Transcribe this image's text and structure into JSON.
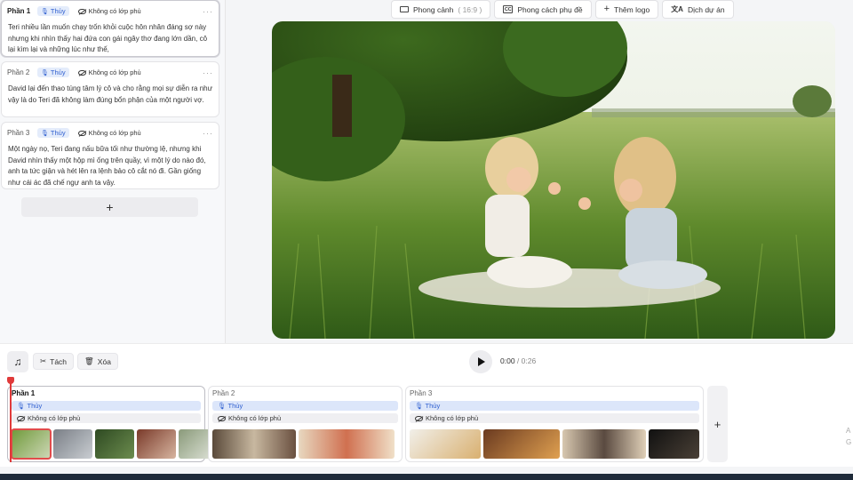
{
  "scenes": [
    {
      "label": "Phần 1",
      "voice": "Thủy",
      "overlay": "Không có lớp phủ",
      "text": "Teri nhiều lần muốn chạy trốn khỏi cuộc hôn nhân đáng sợ này nhưng khi nhìn thấy hai đứa con gái ngây thơ đang lớn dần, cô lại kìm lại và những lúc như thế,"
    },
    {
      "label": "Phần 2",
      "voice": "Thủy",
      "overlay": "Không có lớp phủ",
      "text": " David lại đến thao túng tâm lý cô và cho rằng mọi sự diễn ra như vậy là do Teri đã không làm đúng bổn phận của một người vợ."
    },
    {
      "label": "Phần 3",
      "voice": "Thủy",
      "overlay": "Không có lớp phủ",
      "text": " Một ngày nọ, Teri đang nấu bữa tối như thường lệ, nhưng khi David nhìn thấy một hộp mì ống trên quầy, vì một lý do nào đó, anh ta tức giận và hét lên ra lệnh bảo cô cắt nó đi. Gần giống như cái ác đã chế ngự anh ta vậy."
    }
  ],
  "add_scene_label": "+",
  "toolbar": {
    "landscape_label": "Phong cảnh",
    "landscape_ratio": "( 16:9 )",
    "subtitle_style_label": "Phong cách phụ đề",
    "add_logo_label": "Thêm logo",
    "translate_label": "Dịch dự án",
    "cc_text": "CC",
    "plus_glyph": "+",
    "translate_glyph": "文A"
  },
  "controls": {
    "split_label": "Tách",
    "delete_label": "Xóa",
    "current_time": "0:00",
    "separator": " / ",
    "duration": "0:26",
    "music_glyph": "♫",
    "split_glyph": "✂",
    "delete_glyph": "🗑"
  },
  "timeline": [
    {
      "label": "Phần 1",
      "voice": "Thủy",
      "overlay": "Không có lớp phủ"
    },
    {
      "label": "Phần 2",
      "voice": "Thủy",
      "overlay": "Không có lớp phủ"
    },
    {
      "label": "Phần 3",
      "voice": "Thủy",
      "overlay": "Không có lớp phủ"
    }
  ],
  "timeline_add_label": "+",
  "edge_letters": [
    "A",
    "G"
  ],
  "more_glyph": "···",
  "colors": {
    "accent": "#2f5fd0",
    "voice_bg": "#dce6fa",
    "playhead": "#e03a3a"
  }
}
